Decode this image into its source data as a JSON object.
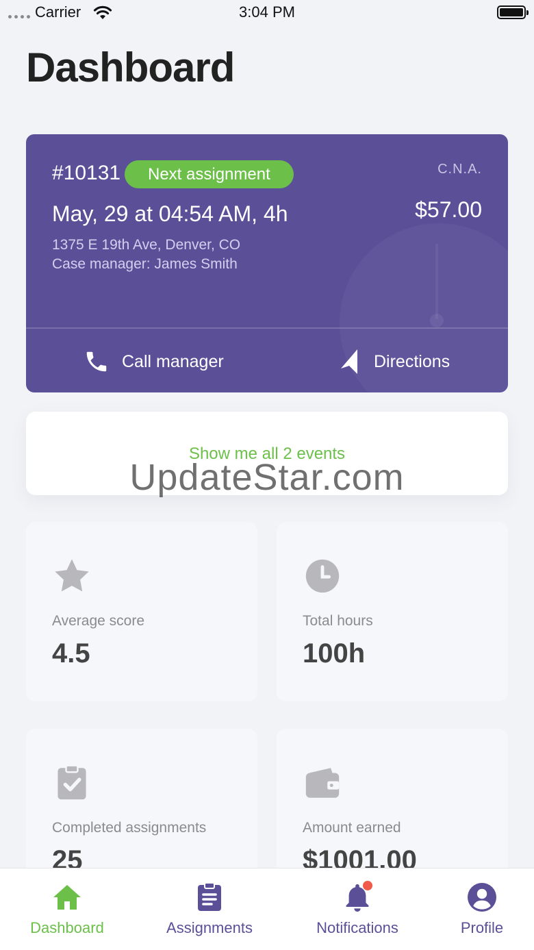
{
  "status_bar": {
    "carrier": "Carrier",
    "time": "3:04 PM"
  },
  "header": {
    "title": "Dashboard"
  },
  "assignment": {
    "id": "#10131",
    "badge": "Next assignment",
    "role": "C.N.A.",
    "datetime": "May, 29 at 04:54 AM, 4h",
    "price": "$57.00",
    "address": "1375 E 19th Ave, Denver, CO",
    "manager": "Case manager: James Smith",
    "call_label": "Call manager",
    "directions_label": "Directions"
  },
  "events": {
    "link_label": "Show me all 2 events"
  },
  "watermark": "UpdateStar.com",
  "stats": [
    {
      "icon": "star-icon",
      "label": "Average score",
      "value": "4.5"
    },
    {
      "icon": "clock-icon",
      "label": "Total hours",
      "value": "100h"
    },
    {
      "icon": "clipboard-check-icon",
      "label": "Completed assignments",
      "value": "25"
    },
    {
      "icon": "wallet-icon",
      "label": "Amount earned",
      "value": "$1001.00"
    }
  ],
  "tabs": [
    {
      "icon": "home-icon",
      "label": "Dashboard",
      "active": true
    },
    {
      "icon": "clipboard-list-icon",
      "label": "Assignments",
      "active": false
    },
    {
      "icon": "bell-icon",
      "label": "Notifications",
      "active": false
    },
    {
      "icon": "user-icon",
      "label": "Profile",
      "active": false
    }
  ],
  "colors": {
    "brand_purple": "#5b4f98",
    "accent_green": "#6cc04a",
    "background": "#f2f3f7",
    "notification_dot": "#f05a4a",
    "stat_icon_gray": "#b8b8bc"
  }
}
